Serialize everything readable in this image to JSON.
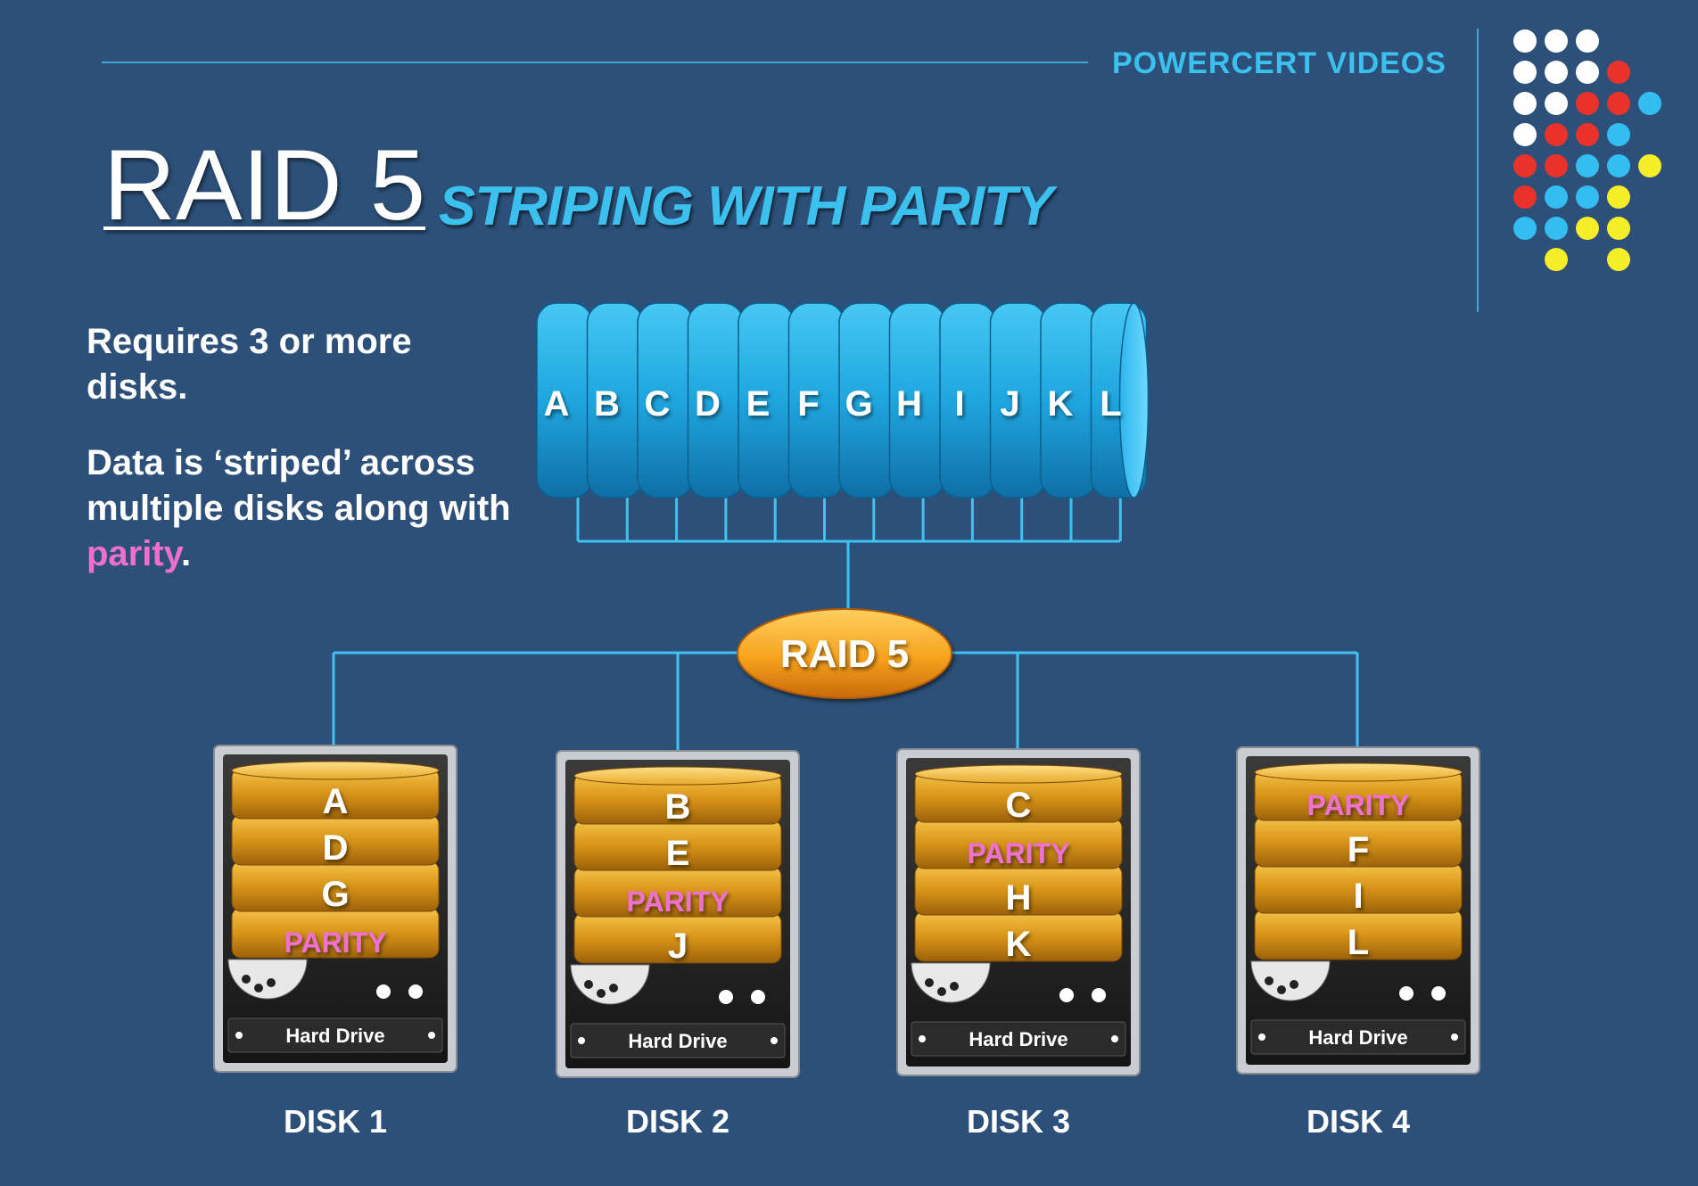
{
  "brand": "POWERCERT VIDEOS",
  "title": "RAID 5",
  "subtitle": "STRIPING WITH PARITY",
  "desc1": "Requires 3 or more disks.",
  "desc2_prefix": "Data is ‘striped’ across multiple disks along with ",
  "desc2_highlight": "parity",
  "desc2_suffix": ".",
  "blocks": [
    "A",
    "B",
    "C",
    "D",
    "E",
    "F",
    "G",
    "H",
    "I",
    "J",
    "K",
    "L"
  ],
  "controller": "RAID 5",
  "drive_label": "Hard Drive",
  "disks": [
    {
      "name": "DISK 1",
      "rows": [
        "A",
        "D",
        "G",
        "PARITY"
      ]
    },
    {
      "name": "DISK 2",
      "rows": [
        "B",
        "E",
        "PARITY",
        "J"
      ]
    },
    {
      "name": "DISK 3",
      "rows": [
        "C",
        "PARITY",
        "H",
        "K"
      ]
    },
    {
      "name": "DISK 4",
      "rows": [
        "PARITY",
        "F",
        "I",
        "L"
      ]
    }
  ],
  "colors": {
    "background": "#2c5079",
    "accent": "#3cc0ee",
    "parity": "#ee6fd0",
    "controller": "#f59a1e",
    "platter": "#e1a21f"
  }
}
